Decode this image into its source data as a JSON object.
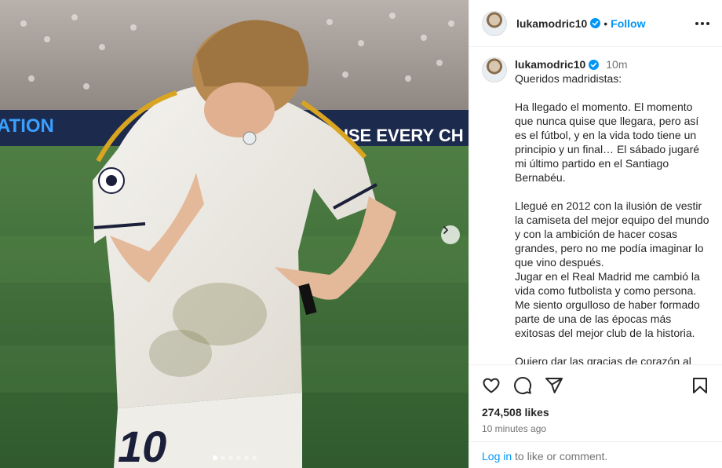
{
  "post": {
    "author": "lukamodric10",
    "follow_label": "Follow",
    "separator": "•",
    "time_relative": "10m",
    "caption": {
      "greeting": "Queridos madridistas:",
      "paragraphs": [
        "Ha llegado el momento. El momento que nunca quise que llegara, pero así es el fútbol, y en la vida todo tiene un principio y un final… El sábado jugaré mi último partido en el Santiago Bernabéu.",
        "Llegué en 2012 con la ilusión de vestir la camiseta del mejor equipo del mundo y con la ambición de hacer cosas grandes, pero no me podía imaginar lo que vino después.\nJugar en el Real Madrid me cambió la vida como futbolista y como persona. Me siento orgulloso de haber formado parte de una de las épocas más exitosas del mejor club de la historia.",
        "Quiero dar las gracias de corazón al"
      ]
    },
    "likes": "274,508 likes",
    "time_ago": "10 minutes ago",
    "login": {
      "link": "Log in",
      "rest": " to like or comment."
    }
  },
  "media": {
    "banner_left": "ATION",
    "banner_right": "USE EVERY CH",
    "shirt_number": "10",
    "carousel": {
      "slides": 6,
      "current": 1
    }
  },
  "icons": {
    "like": "heart-icon",
    "comment": "comment-icon",
    "share": "send-icon",
    "save": "bookmark-icon",
    "next": "chevron-right-icon",
    "verified": "verified-badge-icon",
    "more": "more-options-icon"
  },
  "colors": {
    "accent": "#0095f6",
    "verified": "#0095f6",
    "text": "#262626",
    "muted": "#737373",
    "pitch": "#3d6b3a"
  }
}
